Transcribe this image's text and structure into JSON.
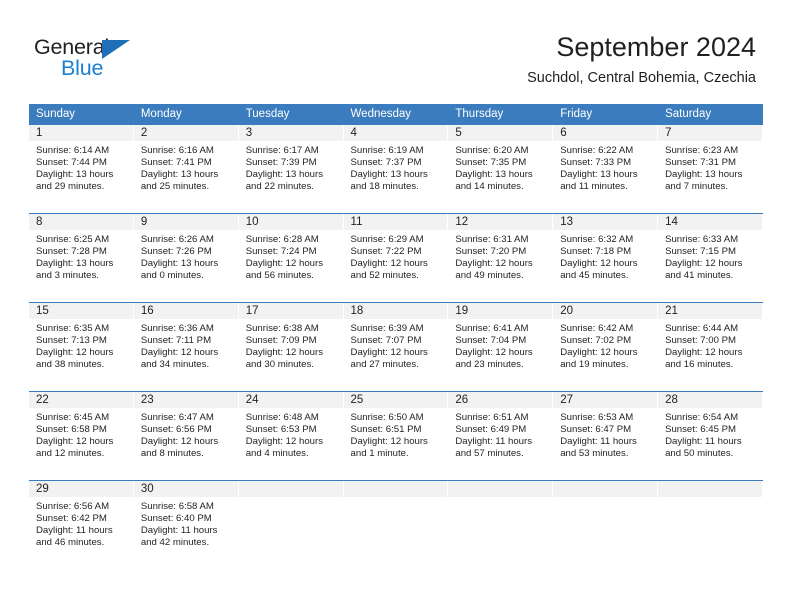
{
  "brand": {
    "name_top": "General",
    "name_bottom": "Blue",
    "triangle_color": "#1f6fb8",
    "blue_text_color": "#1b7fd4"
  },
  "header": {
    "title": "September 2024",
    "subtitle": "Suchdol, Central Bohemia, Czechia"
  },
  "colors": {
    "header_band": "#3a7cbe",
    "daynum_band": "#f2f2f2",
    "row_divider": "#3a7cbe",
    "text": "#231f20"
  },
  "weekday_headers": [
    "Sunday",
    "Monday",
    "Tuesday",
    "Wednesday",
    "Thursday",
    "Friday",
    "Saturday"
  ],
  "weeks": [
    [
      {
        "day": "1",
        "sunrise": "Sunrise: 6:14 AM",
        "sunset": "Sunset: 7:44 PM",
        "daylight1": "Daylight: 13 hours",
        "daylight2": "and 29 minutes."
      },
      {
        "day": "2",
        "sunrise": "Sunrise: 6:16 AM",
        "sunset": "Sunset: 7:41 PM",
        "daylight1": "Daylight: 13 hours",
        "daylight2": "and 25 minutes."
      },
      {
        "day": "3",
        "sunrise": "Sunrise: 6:17 AM",
        "sunset": "Sunset: 7:39 PM",
        "daylight1": "Daylight: 13 hours",
        "daylight2": "and 22 minutes."
      },
      {
        "day": "4",
        "sunrise": "Sunrise: 6:19 AM",
        "sunset": "Sunset: 7:37 PM",
        "daylight1": "Daylight: 13 hours",
        "daylight2": "and 18 minutes."
      },
      {
        "day": "5",
        "sunrise": "Sunrise: 6:20 AM",
        "sunset": "Sunset: 7:35 PM",
        "daylight1": "Daylight: 13 hours",
        "daylight2": "and 14 minutes."
      },
      {
        "day": "6",
        "sunrise": "Sunrise: 6:22 AM",
        "sunset": "Sunset: 7:33 PM",
        "daylight1": "Daylight: 13 hours",
        "daylight2": "and 11 minutes."
      },
      {
        "day": "7",
        "sunrise": "Sunrise: 6:23 AM",
        "sunset": "Sunset: 7:31 PM",
        "daylight1": "Daylight: 13 hours",
        "daylight2": "and 7 minutes."
      }
    ],
    [
      {
        "day": "8",
        "sunrise": "Sunrise: 6:25 AM",
        "sunset": "Sunset: 7:28 PM",
        "daylight1": "Daylight: 13 hours",
        "daylight2": "and 3 minutes."
      },
      {
        "day": "9",
        "sunrise": "Sunrise: 6:26 AM",
        "sunset": "Sunset: 7:26 PM",
        "daylight1": "Daylight: 13 hours",
        "daylight2": "and 0 minutes."
      },
      {
        "day": "10",
        "sunrise": "Sunrise: 6:28 AM",
        "sunset": "Sunset: 7:24 PM",
        "daylight1": "Daylight: 12 hours",
        "daylight2": "and 56 minutes."
      },
      {
        "day": "11",
        "sunrise": "Sunrise: 6:29 AM",
        "sunset": "Sunset: 7:22 PM",
        "daylight1": "Daylight: 12 hours",
        "daylight2": "and 52 minutes."
      },
      {
        "day": "12",
        "sunrise": "Sunrise: 6:31 AM",
        "sunset": "Sunset: 7:20 PM",
        "daylight1": "Daylight: 12 hours",
        "daylight2": "and 49 minutes."
      },
      {
        "day": "13",
        "sunrise": "Sunrise: 6:32 AM",
        "sunset": "Sunset: 7:18 PM",
        "daylight1": "Daylight: 12 hours",
        "daylight2": "and 45 minutes."
      },
      {
        "day": "14",
        "sunrise": "Sunrise: 6:33 AM",
        "sunset": "Sunset: 7:15 PM",
        "daylight1": "Daylight: 12 hours",
        "daylight2": "and 41 minutes."
      }
    ],
    [
      {
        "day": "15",
        "sunrise": "Sunrise: 6:35 AM",
        "sunset": "Sunset: 7:13 PM",
        "daylight1": "Daylight: 12 hours",
        "daylight2": "and 38 minutes."
      },
      {
        "day": "16",
        "sunrise": "Sunrise: 6:36 AM",
        "sunset": "Sunset: 7:11 PM",
        "daylight1": "Daylight: 12 hours",
        "daylight2": "and 34 minutes."
      },
      {
        "day": "17",
        "sunrise": "Sunrise: 6:38 AM",
        "sunset": "Sunset: 7:09 PM",
        "daylight1": "Daylight: 12 hours",
        "daylight2": "and 30 minutes."
      },
      {
        "day": "18",
        "sunrise": "Sunrise: 6:39 AM",
        "sunset": "Sunset: 7:07 PM",
        "daylight1": "Daylight: 12 hours",
        "daylight2": "and 27 minutes."
      },
      {
        "day": "19",
        "sunrise": "Sunrise: 6:41 AM",
        "sunset": "Sunset: 7:04 PM",
        "daylight1": "Daylight: 12 hours",
        "daylight2": "and 23 minutes."
      },
      {
        "day": "20",
        "sunrise": "Sunrise: 6:42 AM",
        "sunset": "Sunset: 7:02 PM",
        "daylight1": "Daylight: 12 hours",
        "daylight2": "and 19 minutes."
      },
      {
        "day": "21",
        "sunrise": "Sunrise: 6:44 AM",
        "sunset": "Sunset: 7:00 PM",
        "daylight1": "Daylight: 12 hours",
        "daylight2": "and 16 minutes."
      }
    ],
    [
      {
        "day": "22",
        "sunrise": "Sunrise: 6:45 AM",
        "sunset": "Sunset: 6:58 PM",
        "daylight1": "Daylight: 12 hours",
        "daylight2": "and 12 minutes."
      },
      {
        "day": "23",
        "sunrise": "Sunrise: 6:47 AM",
        "sunset": "Sunset: 6:56 PM",
        "daylight1": "Daylight: 12 hours",
        "daylight2": "and 8 minutes."
      },
      {
        "day": "24",
        "sunrise": "Sunrise: 6:48 AM",
        "sunset": "Sunset: 6:53 PM",
        "daylight1": "Daylight: 12 hours",
        "daylight2": "and 4 minutes."
      },
      {
        "day": "25",
        "sunrise": "Sunrise: 6:50 AM",
        "sunset": "Sunset: 6:51 PM",
        "daylight1": "Daylight: 12 hours",
        "daylight2": "and 1 minute."
      },
      {
        "day": "26",
        "sunrise": "Sunrise: 6:51 AM",
        "sunset": "Sunset: 6:49 PM",
        "daylight1": "Daylight: 11 hours",
        "daylight2": "and 57 minutes."
      },
      {
        "day": "27",
        "sunrise": "Sunrise: 6:53 AM",
        "sunset": "Sunset: 6:47 PM",
        "daylight1": "Daylight: 11 hours",
        "daylight2": "and 53 minutes."
      },
      {
        "day": "28",
        "sunrise": "Sunrise: 6:54 AM",
        "sunset": "Sunset: 6:45 PM",
        "daylight1": "Daylight: 11 hours",
        "daylight2": "and 50 minutes."
      }
    ],
    [
      {
        "day": "29",
        "sunrise": "Sunrise: 6:56 AM",
        "sunset": "Sunset: 6:42 PM",
        "daylight1": "Daylight: 11 hours",
        "daylight2": "and 46 minutes."
      },
      {
        "day": "30",
        "sunrise": "Sunrise: 6:58 AM",
        "sunset": "Sunset: 6:40 PM",
        "daylight1": "Daylight: 11 hours",
        "daylight2": "and 42 minutes."
      },
      {
        "day": "",
        "sunrise": "",
        "sunset": "",
        "daylight1": "",
        "daylight2": ""
      },
      {
        "day": "",
        "sunrise": "",
        "sunset": "",
        "daylight1": "",
        "daylight2": ""
      },
      {
        "day": "",
        "sunrise": "",
        "sunset": "",
        "daylight1": "",
        "daylight2": ""
      },
      {
        "day": "",
        "sunrise": "",
        "sunset": "",
        "daylight1": "",
        "daylight2": ""
      },
      {
        "day": "",
        "sunrise": "",
        "sunset": "",
        "daylight1": "",
        "daylight2": ""
      }
    ]
  ]
}
